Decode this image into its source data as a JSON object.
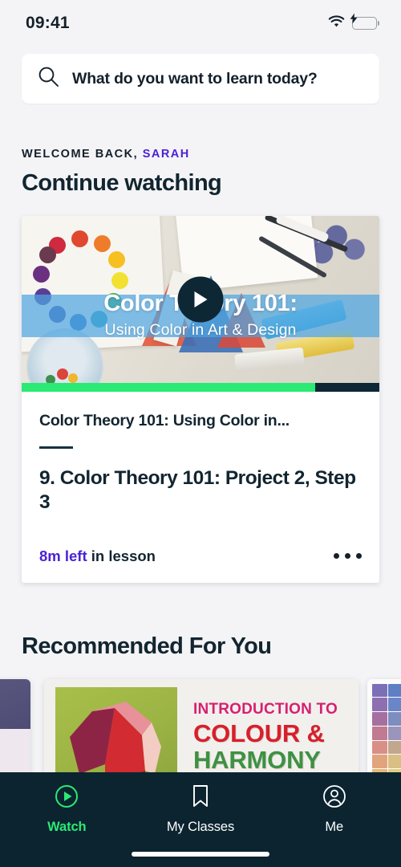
{
  "status_bar": {
    "time": "09:41",
    "wifi_icon": "wifi-icon",
    "battery_icon": "battery-charging-icon",
    "battery_color": "#2ecc4a"
  },
  "search": {
    "icon": "search-icon",
    "placeholder": "What do you want to learn today?"
  },
  "greeting": {
    "prefix": "WELCOME BACK, ",
    "user_name": "SARAH",
    "name_color": "#4b22d5"
  },
  "continue_section": {
    "heading": "Continue watching",
    "card": {
      "thumbnail": {
        "overlay_title": "Color Theory 101:",
        "overlay_subtitle": "Using Color in Art & Design",
        "play_icon": "play-icon",
        "band_color": "#4fa6e2"
      },
      "progress": {
        "percent": 82,
        "fill_color": "#2aea74",
        "track_color": "#0e2734"
      },
      "course_title": "Color Theory 101: Using Color in...",
      "lesson_title": "9. Color Theory 101: Project 2, Step 3",
      "time_left": "8m left",
      "time_left_suffix": " in lesson",
      "time_left_color": "#4b22d5",
      "overflow_icon": "more-options-icon"
    }
  },
  "recommended_section": {
    "heading": "Recommended For You",
    "cards": [
      {
        "position": "left-peek",
        "title": "",
        "top_color": "#5b5880",
        "bottom_color": "#eee7ee"
      },
      {
        "position": "center",
        "line1": "INTRODUCTION TO",
        "line2": "COLOUR &",
        "line3": "HARMONY",
        "line1_color": "#d62070",
        "line2_color": "#d81f2a",
        "line3_color": "#3f9142",
        "artwork": "gem-illustration"
      },
      {
        "position": "right-peek",
        "title": "",
        "artwork": "color-swatch-grid"
      }
    ]
  },
  "tab_bar": {
    "background_color": "#0b2430",
    "active_color": "#2aea74",
    "tabs": [
      {
        "label": "Watch",
        "icon": "play-circle-icon",
        "active": true
      },
      {
        "label": "My Classes",
        "icon": "bookmark-icon",
        "active": false
      },
      {
        "label": "Me",
        "icon": "person-icon",
        "active": false
      }
    ]
  }
}
